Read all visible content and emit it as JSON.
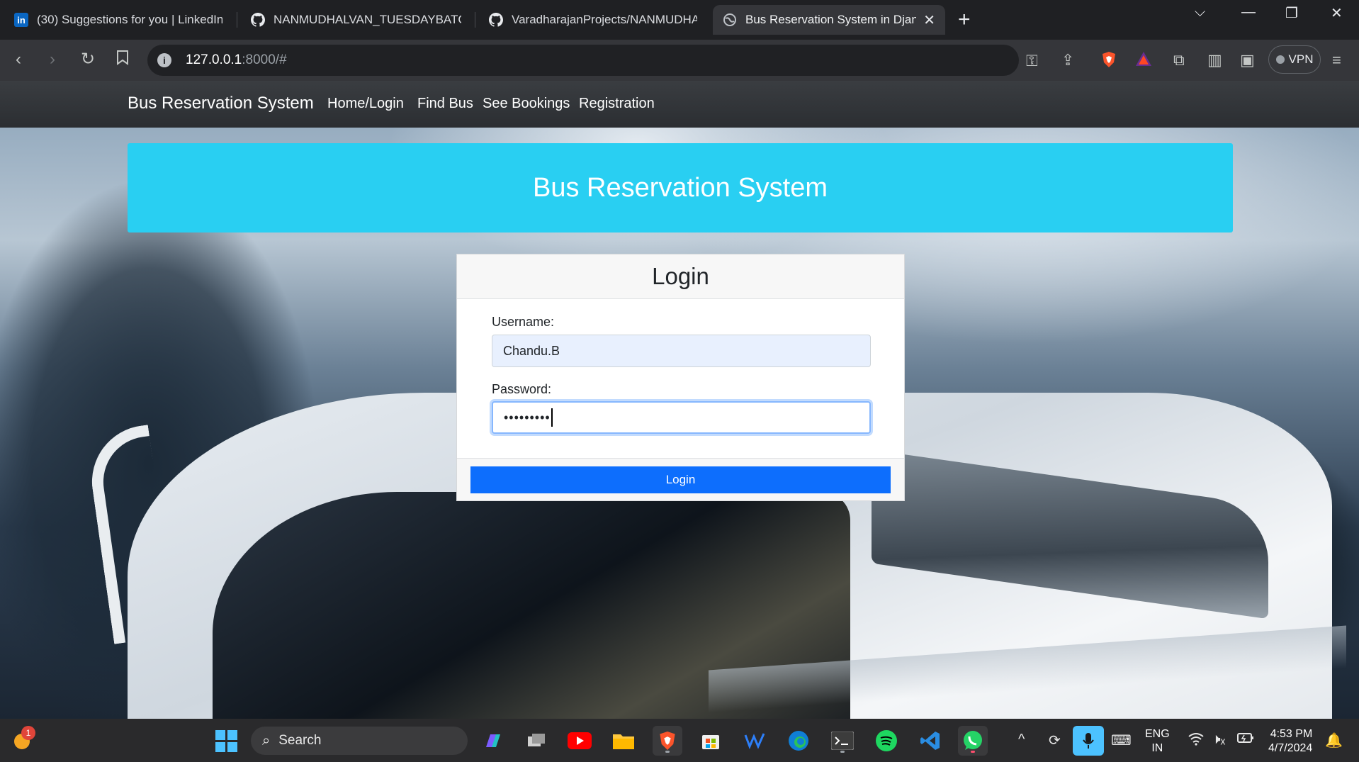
{
  "browser": {
    "tabs": [
      {
        "label": "(30) Suggestions for you | LinkedIn",
        "icon": "linkedin-icon"
      },
      {
        "label": "NANMUDHALVAN_TUESDAYBATCH_",
        "icon": "github-icon"
      },
      {
        "label": "VaradharajanProjects/NANMUDHALV",
        "icon": "github-icon"
      },
      {
        "label": "Bus Reservation System in Djang",
        "icon": "globe-icon",
        "active": true
      }
    ],
    "url_host": "127.0.0.1",
    "url_rest": ":8000/#",
    "vpn_label": "VPN"
  },
  "app": {
    "brand": "Bus Reservation System",
    "nav": [
      "Home/Login",
      "Find Bus",
      "See Bookings",
      "Registration"
    ],
    "hero_title": "Bus Reservation System",
    "login": {
      "title": "Login",
      "username_label": "Username:",
      "username_value": "Chandu.B",
      "password_label": "Password:",
      "password_value": "•••••••••",
      "button_label": "Login"
    }
  },
  "taskbar": {
    "search_placeholder": "Search",
    "notification_count": "1",
    "language": "ENG",
    "region": "IN",
    "time": "4:53 PM",
    "date": "4/7/2024"
  },
  "colors": {
    "hero": "#29cff2",
    "primary_button": "#0d6efd",
    "navbar": "#343a40"
  }
}
